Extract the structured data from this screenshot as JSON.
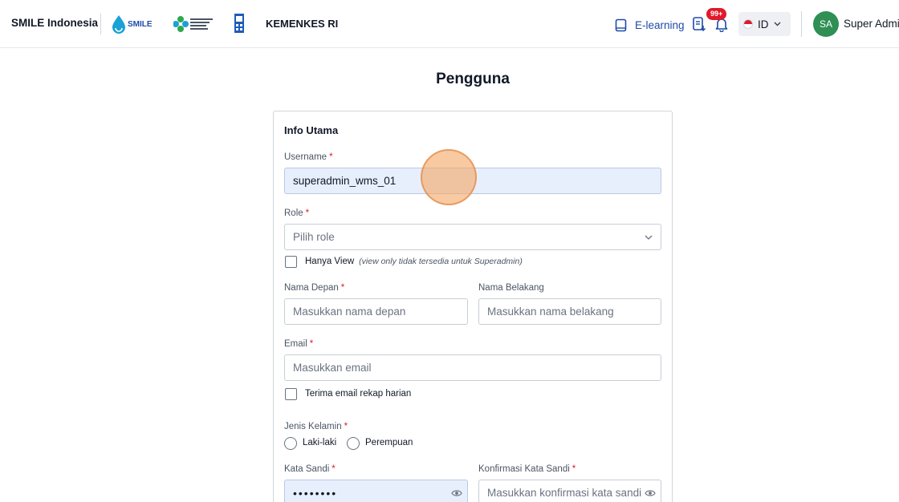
{
  "header": {
    "brand": "SMILE Indonesia",
    "smile_logo_text": "SMILE",
    "kemenkes_logo_text": "KEMENTERIAN KESEHATAN REPUBLIK INDONESIA",
    "org": "KEMENKES RI",
    "elearning_label": "E-learning",
    "notification_badge": "99+",
    "language": "ID",
    "avatar_initials": "SA",
    "user_name": "Super Admin"
  },
  "page": {
    "title": "Pengguna",
    "section_title": "Info Utama"
  },
  "form": {
    "username": {
      "label": "Username",
      "required": "*",
      "value": "superadmin_wms_01"
    },
    "role": {
      "label": "Role",
      "required": "*",
      "placeholder": "Pilih role"
    },
    "view_only": {
      "label": "Hanya View",
      "note": "(view only tidak tersedia untuk Superadmin)"
    },
    "first_name": {
      "label": "Nama Depan",
      "required": "*",
      "placeholder": "Masukkan nama depan"
    },
    "last_name": {
      "label": "Nama Belakang",
      "placeholder": "Masukkan nama belakang"
    },
    "email": {
      "label": "Email",
      "required": "*",
      "placeholder": "Masukkan email"
    },
    "daily_recap": {
      "label": "Terima email rekap harian"
    },
    "gender": {
      "label": "Jenis Kelamin",
      "required": "*",
      "options": [
        "Laki-laki",
        "Perempuan"
      ]
    },
    "password": {
      "label": "Kata Sandi",
      "required": "*",
      "value": "••••••••"
    },
    "password_confirm": {
      "label": "Konfirmasi Kata Sandi",
      "required": "*",
      "placeholder": "Masukkan konfirmasi kata sandi"
    }
  },
  "colors": {
    "accent": "#1e4aa8",
    "required": "#e0192b",
    "avatar": "#2f8f54",
    "filled_field": "#e8effc"
  }
}
